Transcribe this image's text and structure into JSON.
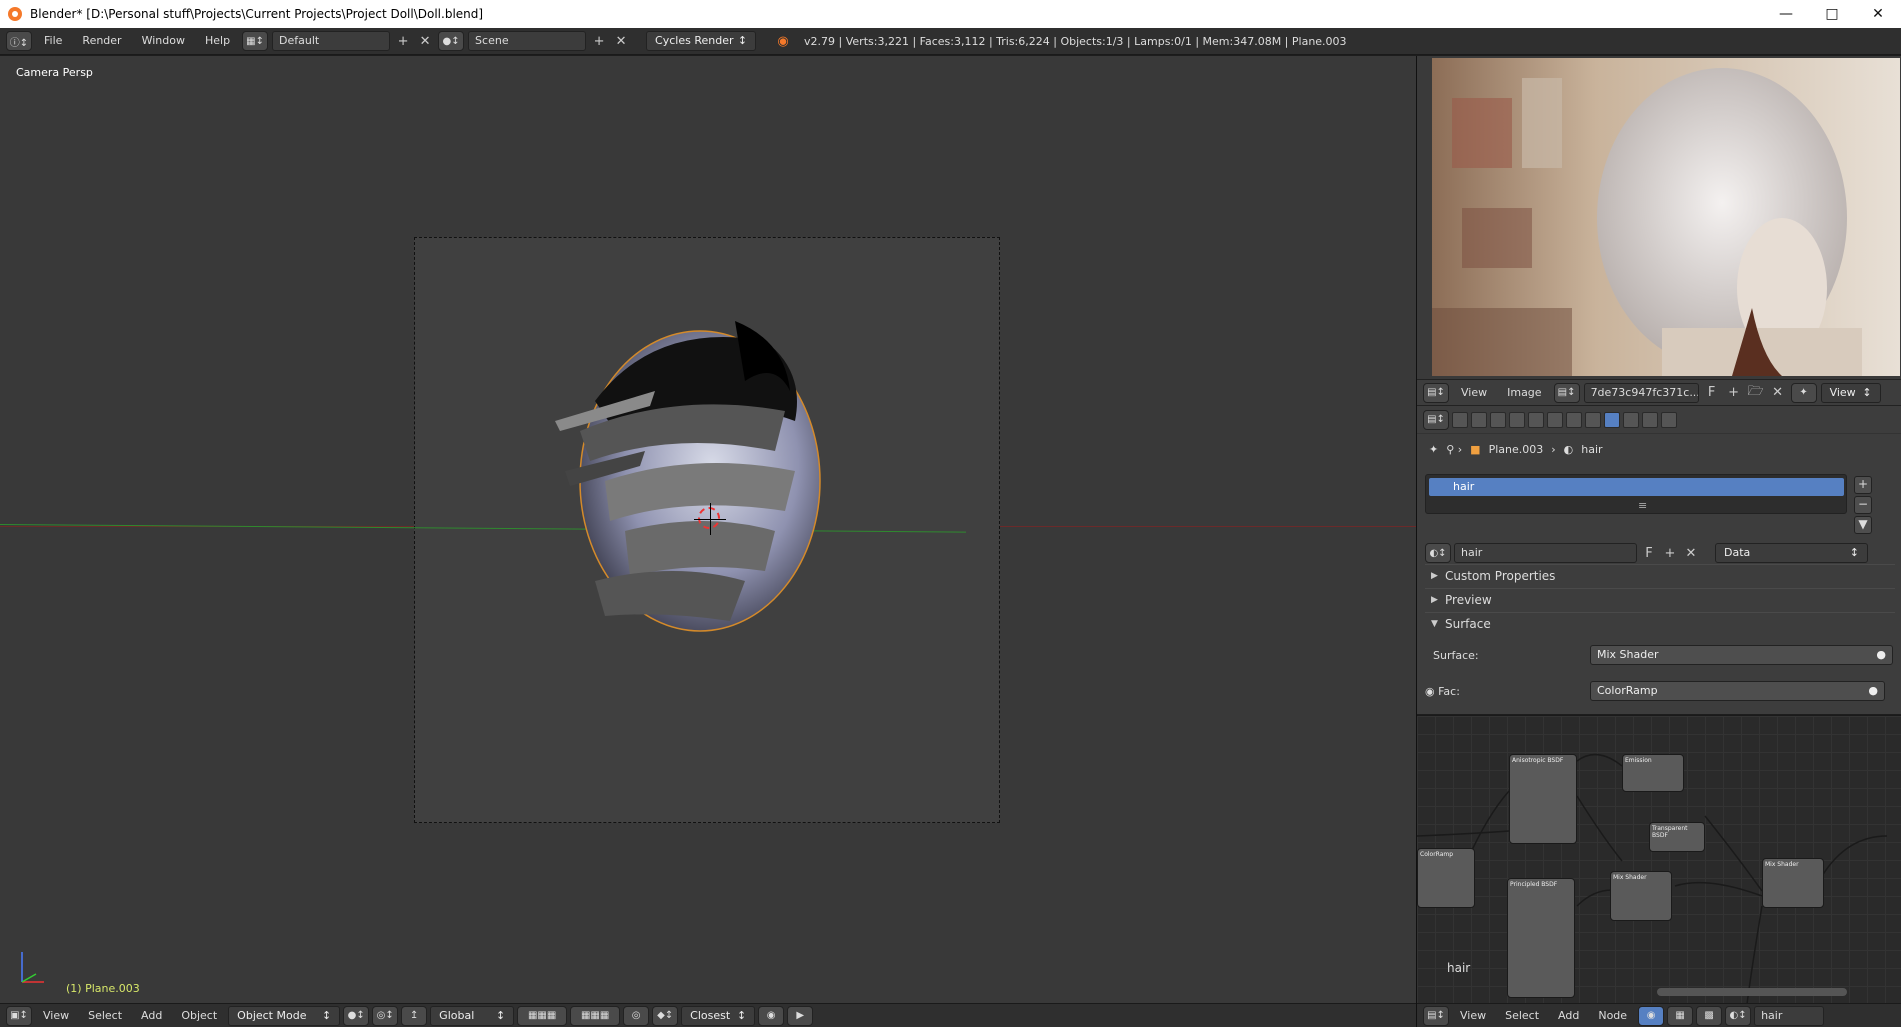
{
  "window": {
    "title": "Blender* [D:\\Personal stuff\\Projects\\Current Projects\\Project Doll\\Doll.blend]",
    "minimize_icon": "minimize-icon",
    "maximize_icon": "maximize-icon",
    "close_icon": "close-icon"
  },
  "info_header": {
    "menus": [
      "File",
      "Render",
      "Window",
      "Help"
    ],
    "screen_layout": "Default",
    "scene": "Scene",
    "render_engine": "Cycles Render",
    "stats": "v2.79 | Verts:3,221 | Faces:3,112 | Tris:6,224 | Objects:1/3 | Lamps:0/1 | Mem:347.08M | Plane.003"
  },
  "viewport": {
    "view_label": "Camera Persp",
    "object_label": "(1) Plane.003"
  },
  "viewport_header": {
    "menus": [
      "View",
      "Select",
      "Add",
      "Object"
    ],
    "mode": "Object Mode",
    "orientation": "Global",
    "snap_target": "Closest"
  },
  "image_editor": {
    "menus": [
      "View",
      "Image"
    ],
    "image_name": "7de73c947fc371c...",
    "fake_user": "F",
    "view_dropdown": "View"
  },
  "properties": {
    "breadcrumb": [
      "Plane.003",
      "hair"
    ],
    "slot_selected": "hair",
    "material_name": "hair",
    "fake_user": "F",
    "link_dropdown": "Data",
    "panels": {
      "custom_properties": "Custom Properties",
      "preview": "Preview",
      "surface": "Surface"
    },
    "surface_label": "Surface:",
    "surface_value": "Mix Shader",
    "fac_label": "Fac:",
    "fac_value": "ColorRamp"
  },
  "node_editor": {
    "material_label": "hair",
    "nodes": [
      {
        "title": "Anisotropic BSDF"
      },
      {
        "title": "Emission"
      },
      {
        "title": "Transparent BSDF"
      },
      {
        "title": "Mix Shader"
      },
      {
        "title": "Principled BSDF"
      },
      {
        "title": "Mix Shader"
      },
      {
        "title": "ColorRamp"
      }
    ]
  },
  "node_header": {
    "menus": [
      "View",
      "Select",
      "Add",
      "Node"
    ],
    "material": "hair"
  },
  "colors": {
    "selection": "#5680c2",
    "object_label": "#d8e86a"
  }
}
